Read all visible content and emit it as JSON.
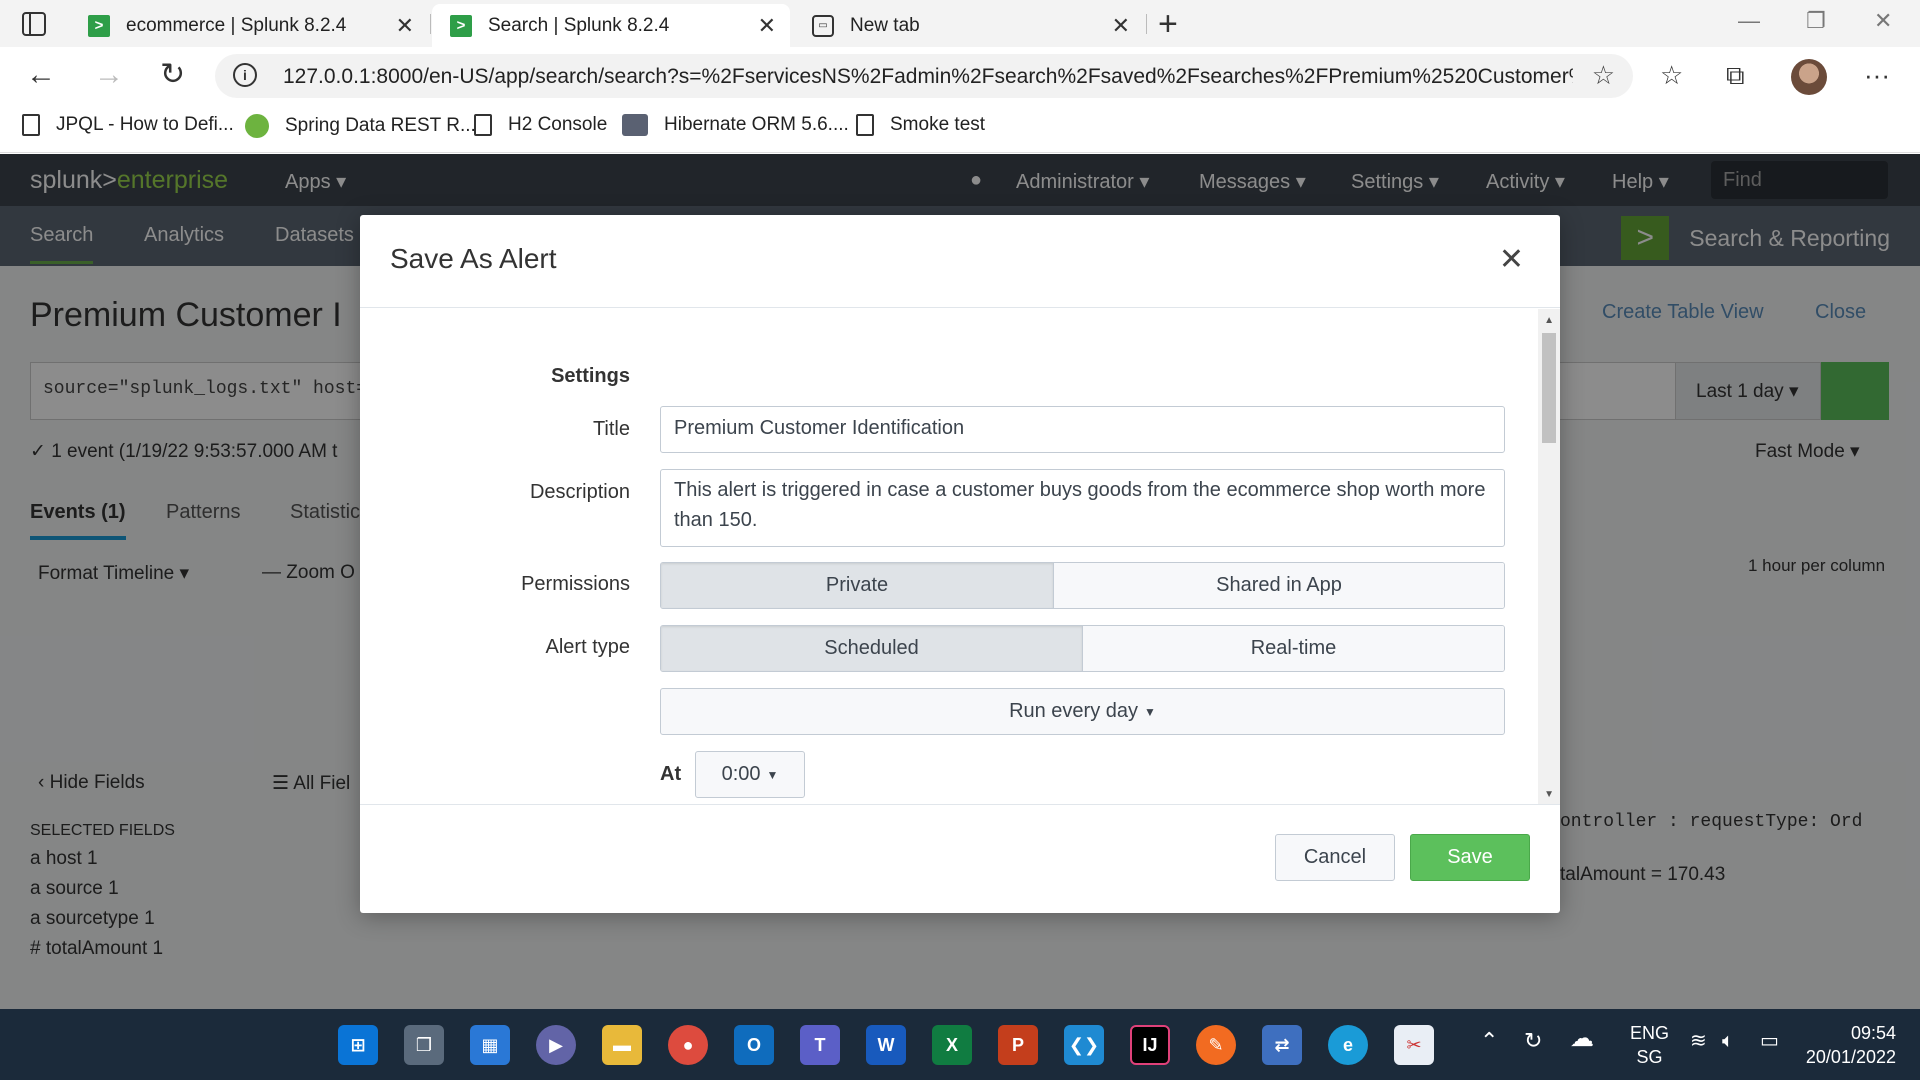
{
  "browser": {
    "tabs": [
      {
        "label": "ecommerce | Splunk 8.2.4",
        "favicon": "splunk-icon"
      },
      {
        "label": "Search | Splunk 8.2.4",
        "favicon": "splunk-icon",
        "active": true
      },
      {
        "label": "New tab",
        "favicon": "new-tab-icon"
      }
    ],
    "url": "127.0.0.1:8000/en-US/app/search/search?s=%2FservicesNS%2Fadmin%2Fsearch%2Fsaved%2Fsearches%2FPremium%2520Customer%25...",
    "bookmarks": [
      "JPQL - How to Defi...",
      "Spring Data REST R...",
      "H2 Console",
      "Hibernate ORM 5.6....",
      "Smoke test"
    ]
  },
  "splunk": {
    "logo_main": "splunk>",
    "logo_sub": "enterprise",
    "top_menu": {
      "apps": "Apps",
      "admin": "Administrator",
      "messages": "Messages",
      "settings": "Settings",
      "activity": "Activity",
      "help": "Help",
      "find_placeholder": "Find"
    },
    "nav": {
      "search": "Search",
      "analytics": "Analytics",
      "datasets": "Datasets",
      "app_name": "Search & Reporting"
    },
    "page_title": "Premium Customer I",
    "create_table_view": "Create Table View",
    "close": "Close",
    "search_query": "source=\"splunk_logs.txt\" host=",
    "time_range": "Last 1 day",
    "event_summary": "✓ 1 event (1/19/22 9:53:57.000 AM t",
    "fast_mode": "Fast Mode",
    "result_tabs": [
      "Events (1)",
      "Patterns",
      "Statistic"
    ],
    "format_timeline": "Format Timeline",
    "zoom_out": "— Zoom O",
    "per_column": "1 hour per column",
    "hide_fields": "Hide Fields",
    "all_fields": "All Fiel",
    "selected_fields_header": "SELECTED FIELDS",
    "selected_fields": [
      "a  host  1",
      "a  source  1",
      "a  sourcetype  1",
      "#  totalAmount  1"
    ],
    "event_snippet_1": "ontroller      : requestType: Ord",
    "event_snippet_2": "talAmount = 170.43"
  },
  "modal": {
    "title": "Save As Alert",
    "section_settings": "Settings",
    "title_label": "Title",
    "title_value": "Premium Customer Identification",
    "description_label": "Description",
    "description_value": "This alert is triggered in case a customer buys goods from the ecommerce shop worth more than 150.",
    "permissions_label": "Permissions",
    "permissions_options": [
      "Private",
      "Shared in App"
    ],
    "permissions_selected": "Private",
    "alert_type_label": "Alert type",
    "alert_type_options": [
      "Scheduled",
      "Real-time"
    ],
    "alert_type_selected": "Scheduled",
    "schedule": "Run every day",
    "at_label": "At",
    "at_value": "0:00",
    "cancel": "Cancel",
    "save": "Save"
  },
  "taskbar": {
    "language": "ENG",
    "region": "SG",
    "time": "09:54",
    "date": "20/01/2022"
  },
  "colors": {
    "splunk_topbar": "#3c444d",
    "splunk_nav": "#5c6773",
    "accent_green": "#5cc05c",
    "taskbar": "#1b2a3a"
  }
}
